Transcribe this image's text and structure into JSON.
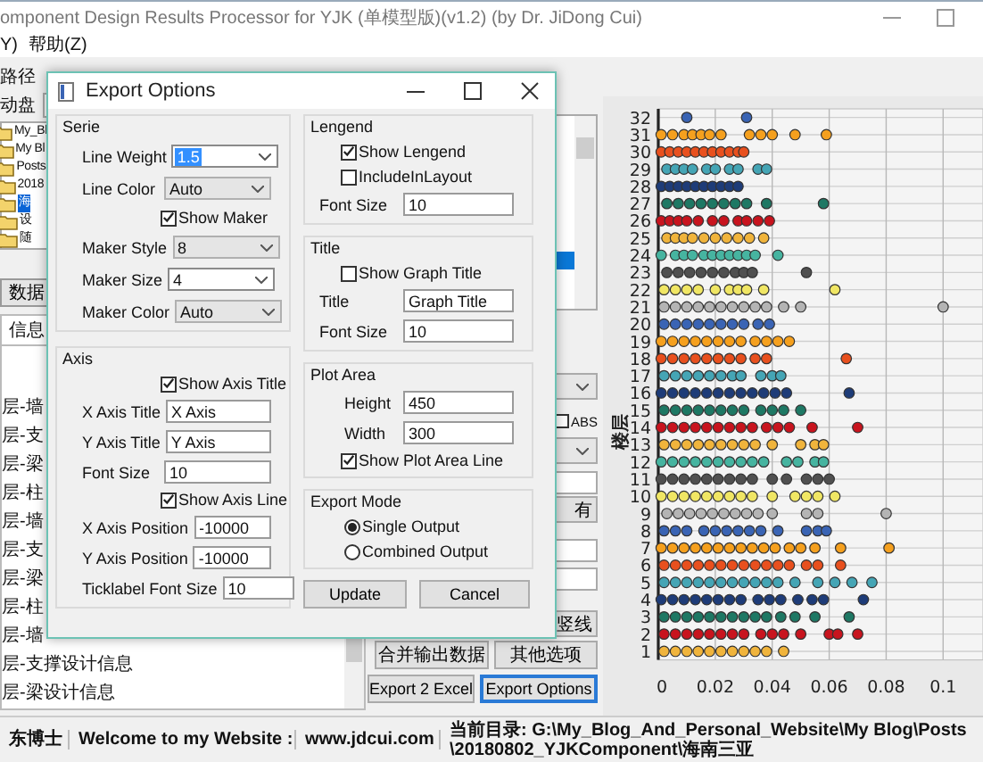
{
  "main_window": {
    "title": "omponent Design Results Processor for YJK (单模型版)(v1.2) (by Dr. JiDong Cui)",
    "menu": [
      "Y)",
      "帮助(Z)"
    ]
  },
  "left_panel": {
    "path_label": "路径",
    "drive_label": "动盘",
    "tree": [
      {
        "label": "My_Bl",
        "selected": false,
        "children": [
          {
            "label": "My Bl",
            "selected": false,
            "children": [
              {
                "label": "Posts",
                "selected": false,
                "children": [
                  {
                    "label": "2018",
                    "selected": false,
                    "children": [
                      {
                        "label": "海",
                        "selected": true,
                        "children": [
                          {
                            "label": "设",
                            "selected": false
                          },
                          {
                            "label": "随",
                            "selected": false
                          }
                        ]
                      }
                    ]
                  }
                ]
              }
            ]
          }
        ]
      }
    ],
    "data_button": "数据",
    "tab": "信息",
    "list_items": [
      "层-墙",
      "层-支",
      "层-梁",
      "层-柱",
      "层-墙",
      "层-支",
      "层-梁",
      "层-柱",
      "层-墙",
      "层-支撑设计信息",
      "层-梁设计信息"
    ]
  },
  "side_controls": {
    "abs": {
      "label": "ABS",
      "checked": false
    },
    "all_button": "有",
    "vline_button": "竖线",
    "buttons": [
      {
        "label": "合并输出数据",
        "focused": false
      },
      {
        "label": "其他选项",
        "focused": false
      },
      {
        "label": "Export 2 Excel",
        "focused": false
      },
      {
        "label": "Export Options",
        "focused": true
      }
    ]
  },
  "chart": {
    "chart_data": {
      "type": "scatter",
      "grid": true,
      "ylabel": "楼层",
      "xlim": [
        0,
        0.114
      ],
      "ylim": [
        0.5,
        32.5
      ],
      "xticks": [
        0,
        0.02,
        0.04,
        0.06,
        0.08,
        0.1
      ],
      "yticks": [
        1,
        2,
        3,
        4,
        5,
        6,
        7,
        8,
        9,
        10,
        11,
        12,
        13,
        14,
        15,
        16,
        17,
        18,
        19,
        20,
        21,
        22,
        23,
        24,
        25,
        26,
        27,
        28,
        29,
        30,
        31,
        32
      ],
      "series": [
        {
          "color": "#3a64b4",
          "x": [
            0.01,
            0.031
          ],
          "values": [
            32,
            32
          ]
        },
        {
          "color": "#f5a01e",
          "x": [
            0.001,
            0.005,
            0.009,
            0.012,
            0.015,
            0.018,
            0.022,
            0.032,
            0.036,
            0.04,
            0.048,
            0.059
          ],
          "values": [
            31,
            31,
            31,
            31,
            31,
            31,
            31,
            31,
            31,
            31,
            31,
            31
          ]
        },
        {
          "color": "#e8501e",
          "x": [
            0.001,
            0.004,
            0.007,
            0.01,
            0.013,
            0.016,
            0.019,
            0.022,
            0.025,
            0.028,
            0.03
          ],
          "values": [
            30,
            30,
            30,
            30,
            30,
            30,
            30,
            30,
            30,
            30,
            30
          ]
        },
        {
          "color": "#45a5b5",
          "x": [
            0.003,
            0.006,
            0.009,
            0.012,
            0.017,
            0.02,
            0.025,
            0.028,
            0.035,
            0.038
          ],
          "values": [
            29,
            29,
            29,
            29,
            29,
            29,
            29,
            29,
            29,
            29
          ]
        },
        {
          "color": "#1e3c78",
          "x": [
            0.001,
            0.004,
            0.007,
            0.01,
            0.013,
            0.016,
            0.019,
            0.022,
            0.025,
            0.028
          ],
          "values": [
            28,
            28,
            28,
            28,
            28,
            28,
            28,
            28,
            28,
            28
          ]
        },
        {
          "color": "#1e7864",
          "x": [
            0.003,
            0.007,
            0.011,
            0.015,
            0.019,
            0.023,
            0.027,
            0.031,
            0.038,
            0.058
          ],
          "values": [
            27,
            27,
            27,
            27,
            27,
            27,
            27,
            27,
            27,
            27
          ]
        },
        {
          "color": "#c8141e",
          "x": [
            0.001,
            0.004,
            0.007,
            0.01,
            0.014,
            0.019,
            0.023,
            0.028,
            0.031,
            0.035,
            0.039
          ],
          "values": [
            26,
            26,
            26,
            26,
            26,
            26,
            26,
            26,
            26,
            26,
            26
          ]
        },
        {
          "color": "#f0b43c",
          "x": [
            0.003,
            0.006,
            0.009,
            0.012,
            0.016,
            0.02,
            0.024,
            0.028,
            0.032,
            0.037
          ],
          "values": [
            25,
            25,
            25,
            25,
            25,
            25,
            25,
            25,
            25,
            25
          ]
        },
        {
          "color": "#46b4a0",
          "x": [
            0.001,
            0.006,
            0.009,
            0.012,
            0.016,
            0.019,
            0.022,
            0.025,
            0.028,
            0.031,
            0.034,
            0.042
          ],
          "values": [
            24,
            24,
            24,
            24,
            24,
            24,
            24,
            24,
            24,
            24,
            24,
            24
          ]
        },
        {
          "color": "#505050",
          "x": [
            0.003,
            0.007,
            0.011,
            0.015,
            0.019,
            0.023,
            0.027,
            0.03,
            0.033,
            0.052
          ],
          "values": [
            23,
            23,
            23,
            23,
            23,
            23,
            23,
            23,
            23,
            23
          ]
        },
        {
          "color": "#f0e664",
          "x": [
            0.002,
            0.006,
            0.01,
            0.014,
            0.02,
            0.025,
            0.028,
            0.031,
            0.037,
            0.062
          ],
          "values": [
            22,
            22,
            22,
            22,
            22,
            22,
            22,
            22,
            22,
            22
          ]
        },
        {
          "color": "#b4b4b4",
          "x": [
            0.002,
            0.006,
            0.01,
            0.014,
            0.018,
            0.022,
            0.026,
            0.03,
            0.034,
            0.038,
            0.044,
            0.05,
            0.1
          ],
          "values": [
            21,
            21,
            21,
            21,
            21,
            21,
            21,
            21,
            21,
            21,
            21,
            21,
            21
          ]
        },
        {
          "color": "#3a64b4",
          "x": [
            0.002,
            0.006,
            0.01,
            0.014,
            0.018,
            0.022,
            0.026,
            0.03,
            0.035,
            0.039
          ],
          "values": [
            20,
            20,
            20,
            20,
            20,
            20,
            20,
            20,
            20,
            20
          ]
        },
        {
          "color": "#f5a01e",
          "x": [
            0.001,
            0.005,
            0.009,
            0.013,
            0.017,
            0.021,
            0.025,
            0.029,
            0.034,
            0.038,
            0.042,
            0.046
          ],
          "values": [
            19,
            19,
            19,
            19,
            19,
            19,
            19,
            19,
            19,
            19,
            19,
            19
          ]
        },
        {
          "color": "#e8501e",
          "x": [
            0.001,
            0.005,
            0.009,
            0.013,
            0.017,
            0.021,
            0.025,
            0.029,
            0.034,
            0.038,
            0.066
          ],
          "values": [
            18,
            18,
            18,
            18,
            18,
            18,
            18,
            18,
            18,
            18,
            18
          ]
        },
        {
          "color": "#45a5b5",
          "x": [
            0.002,
            0.006,
            0.01,
            0.014,
            0.018,
            0.022,
            0.026,
            0.029,
            0.036,
            0.04,
            0.043
          ],
          "values": [
            17,
            17,
            17,
            17,
            17,
            17,
            17,
            17,
            17,
            17,
            17
          ]
        },
        {
          "color": "#1e3c78",
          "x": [
            0.001,
            0.005,
            0.009,
            0.013,
            0.017,
            0.021,
            0.025,
            0.029,
            0.033,
            0.037,
            0.041,
            0.045,
            0.067
          ],
          "values": [
            16,
            16,
            16,
            16,
            16,
            16,
            16,
            16,
            16,
            16,
            16,
            16,
            16
          ]
        },
        {
          "color": "#1e7864",
          "x": [
            0.002,
            0.006,
            0.01,
            0.014,
            0.018,
            0.022,
            0.026,
            0.03,
            0.036,
            0.04,
            0.044,
            0.05
          ],
          "values": [
            15,
            15,
            15,
            15,
            15,
            15,
            15,
            15,
            15,
            15,
            15,
            15
          ]
        },
        {
          "color": "#c8141e",
          "x": [
            0.001,
            0.005,
            0.009,
            0.013,
            0.017,
            0.021,
            0.025,
            0.029,
            0.033,
            0.038,
            0.042,
            0.046,
            0.054,
            0.07
          ],
          "values": [
            14,
            14,
            14,
            14,
            14,
            14,
            14,
            14,
            14,
            14,
            14,
            14,
            14,
            14
          ]
        },
        {
          "color": "#f0b43c",
          "x": [
            0.002,
            0.006,
            0.01,
            0.014,
            0.018,
            0.022,
            0.026,
            0.03,
            0.034,
            0.04,
            0.05,
            0.055,
            0.058
          ],
          "values": [
            13,
            13,
            13,
            13,
            13,
            13,
            13,
            13,
            13,
            13,
            13,
            13,
            13
          ]
        },
        {
          "color": "#46b4a0",
          "x": [
            0.001,
            0.005,
            0.009,
            0.013,
            0.017,
            0.021,
            0.025,
            0.029,
            0.033,
            0.037,
            0.045,
            0.049,
            0.055,
            0.058
          ],
          "values": [
            12,
            12,
            12,
            12,
            12,
            12,
            12,
            12,
            12,
            12,
            12,
            12,
            12,
            12
          ]
        },
        {
          "color": "#505050",
          "x": [
            0.001,
            0.005,
            0.009,
            0.013,
            0.017,
            0.021,
            0.025,
            0.029,
            0.033,
            0.04,
            0.045,
            0.052,
            0.056,
            0.06
          ],
          "values": [
            11,
            11,
            11,
            11,
            11,
            11,
            11,
            11,
            11,
            11,
            11,
            11,
            11,
            11
          ]
        },
        {
          "color": "#f0e664",
          "x": [
            0.001,
            0.005,
            0.009,
            0.013,
            0.017,
            0.021,
            0.025,
            0.029,
            0.033,
            0.04,
            0.048,
            0.052,
            0.056,
            0.062
          ],
          "values": [
            10,
            10,
            10,
            10,
            10,
            10,
            10,
            10,
            10,
            10,
            10,
            10,
            10,
            10
          ]
        },
        {
          "color": "#b4b4b4",
          "x": [
            0.003,
            0.007,
            0.011,
            0.015,
            0.019,
            0.023,
            0.027,
            0.031,
            0.035,
            0.04,
            0.052,
            0.056,
            0.08
          ],
          "values": [
            9,
            9,
            9,
            9,
            9,
            9,
            9,
            9,
            9,
            9,
            9,
            9,
            9
          ]
        },
        {
          "color": "#3a64b4",
          "x": [
            0.002,
            0.006,
            0.01,
            0.016,
            0.02,
            0.024,
            0.028,
            0.032,
            0.036,
            0.042,
            0.052,
            0.056,
            0.059
          ],
          "values": [
            8,
            8,
            8,
            8,
            8,
            8,
            8,
            8,
            8,
            8,
            8,
            8,
            8
          ]
        },
        {
          "color": "#f5a01e",
          "x": [
            0.001,
            0.005,
            0.009,
            0.013,
            0.017,
            0.021,
            0.025,
            0.029,
            0.033,
            0.037,
            0.041,
            0.046,
            0.05,
            0.055,
            0.064,
            0.081
          ],
          "values": [
            7,
            7,
            7,
            7,
            7,
            7,
            7,
            7,
            7,
            7,
            7,
            7,
            7,
            7,
            7,
            7
          ]
        },
        {
          "color": "#e8501e",
          "x": [
            0.002,
            0.006,
            0.01,
            0.014,
            0.018,
            0.022,
            0.026,
            0.03,
            0.034,
            0.038,
            0.042,
            0.046,
            0.052,
            0.056,
            0.064
          ],
          "values": [
            6,
            6,
            6,
            6,
            6,
            6,
            6,
            6,
            6,
            6,
            6,
            6,
            6,
            6,
            6
          ]
        },
        {
          "color": "#45a5b5",
          "x": [
            0.002,
            0.006,
            0.01,
            0.014,
            0.018,
            0.022,
            0.026,
            0.03,
            0.034,
            0.038,
            0.042,
            0.048,
            0.056,
            0.062,
            0.068,
            0.075
          ],
          "values": [
            5,
            5,
            5,
            5,
            5,
            5,
            5,
            5,
            5,
            5,
            5,
            5,
            5,
            5,
            5,
            5
          ]
        },
        {
          "color": "#1e3c78",
          "x": [
            0.001,
            0.005,
            0.009,
            0.013,
            0.017,
            0.021,
            0.025,
            0.029,
            0.035,
            0.039,
            0.043,
            0.049,
            0.054,
            0.058,
            0.072
          ],
          "values": [
            4,
            4,
            4,
            4,
            4,
            4,
            4,
            4,
            4,
            4,
            4,
            4,
            4,
            4,
            4
          ]
        },
        {
          "color": "#1e7864",
          "x": [
            0.002,
            0.006,
            0.01,
            0.014,
            0.018,
            0.022,
            0.026,
            0.03,
            0.034,
            0.038,
            0.043,
            0.048,
            0.055,
            0.067
          ],
          "values": [
            3,
            3,
            3,
            3,
            3,
            3,
            3,
            3,
            3,
            3,
            3,
            3,
            3,
            3
          ]
        },
        {
          "color": "#c8141e",
          "x": [
            0.002,
            0.006,
            0.01,
            0.014,
            0.018,
            0.022,
            0.026,
            0.03,
            0.036,
            0.04,
            0.044,
            0.05,
            0.06,
            0.063,
            0.07
          ],
          "values": [
            2,
            2,
            2,
            2,
            2,
            2,
            2,
            2,
            2,
            2,
            2,
            2,
            2,
            2,
            2
          ]
        },
        {
          "color": "#f0b43c",
          "x": [
            0.002,
            0.006,
            0.01,
            0.014,
            0.018,
            0.022,
            0.026,
            0.03,
            0.034,
            0.038,
            0.044
          ],
          "values": [
            1,
            1,
            1,
            1,
            1,
            1,
            1,
            1,
            1,
            1,
            1
          ]
        }
      ]
    }
  },
  "dialog": {
    "title": "Export Options",
    "left_groups": [
      {
        "title": "Serie",
        "rows": [
          {
            "kind": "select",
            "label": "Line Weight",
            "value": "1.5",
            "editable": true,
            "highlighted": true
          },
          {
            "kind": "select",
            "label": "Line Color",
            "value": "Auto",
            "editable": false,
            "highlighted": false
          },
          {
            "kind": "checkbox",
            "label": "Show Maker",
            "checked": true
          },
          {
            "kind": "select",
            "label": "Maker Style",
            "value": "8",
            "editable": false,
            "highlighted": false
          },
          {
            "kind": "select",
            "label": "Maker Size",
            "value": "4",
            "editable": true,
            "highlighted": false
          },
          {
            "kind": "select",
            "label": "Maker Color",
            "value": "Auto",
            "editable": false,
            "highlighted": false
          }
        ]
      },
      {
        "title": "Axis",
        "rows": [
          {
            "kind": "checkbox",
            "label": "Show Axis Title",
            "checked": true
          },
          {
            "kind": "text",
            "label": "X Axis Title",
            "value": "X Axis"
          },
          {
            "kind": "text",
            "label": "Y Axis Title",
            "value": "Y Axis"
          },
          {
            "kind": "text",
            "label": "Font Size",
            "value": "10"
          },
          {
            "kind": "checkbox",
            "label": "Show Axis Line",
            "checked": true
          },
          {
            "kind": "text",
            "label": "X Axis Position",
            "value": "-10000"
          },
          {
            "kind": "text",
            "label": "Y Axis Position",
            "value": "-10000"
          },
          {
            "kind": "text",
            "label": "Ticklabel Font Size",
            "value": "10"
          }
        ]
      }
    ],
    "right_groups": [
      {
        "title": "Lengend",
        "rows": [
          {
            "kind": "checkbox",
            "label": "Show Lengend",
            "checked": true
          },
          {
            "kind": "checkbox",
            "label": "IncludeInLayout",
            "checked": false
          },
          {
            "kind": "text",
            "label": "Font Size",
            "value": "10"
          }
        ]
      },
      {
        "title": "Title",
        "rows": [
          {
            "kind": "checkbox",
            "label": "Show Graph Title",
            "checked": false
          },
          {
            "kind": "text",
            "label": "Title",
            "value": "Graph Title"
          },
          {
            "kind": "text",
            "label": "Font Size",
            "value": "10"
          }
        ]
      },
      {
        "title": "Plot Area",
        "rows": [
          {
            "kind": "text",
            "label": "Height",
            "value": "450"
          },
          {
            "kind": "text",
            "label": "Width",
            "value": "300"
          },
          {
            "kind": "checkbox",
            "label": "Show Plot Area Line",
            "checked": true
          }
        ]
      },
      {
        "title": "Export Mode",
        "rows": [
          {
            "kind": "radio",
            "label": "Single Output",
            "selected": true
          },
          {
            "kind": "radio",
            "label": "Combined Output",
            "selected": false
          }
        ]
      }
    ],
    "buttons": [
      "Update",
      "Cancel"
    ]
  },
  "status_bar": [
    "东博士",
    "Welcome to my Website :",
    "www.jdcui.com",
    "当前目录: G:\\My_Blog_And_Personal_Website\\My Blog\\Posts\\20180802_YJKComponent\\海南三亚"
  ]
}
